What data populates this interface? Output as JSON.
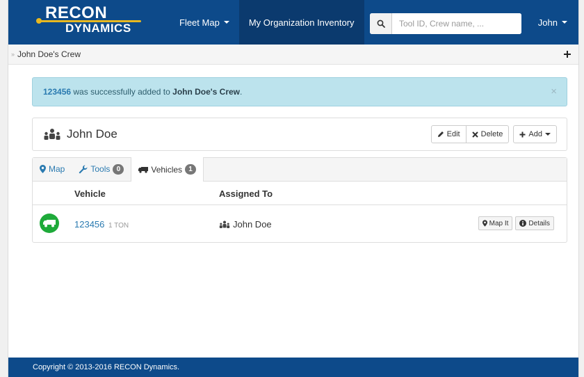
{
  "brand": {
    "line1": "RECON",
    "line2": "DYNAMICS"
  },
  "nav": {
    "fleet_map": "Fleet Map",
    "inventory": "My Organization Inventory",
    "user": "John"
  },
  "search": {
    "placeholder": "Tool ID, Crew name, ..."
  },
  "breadcrumb": {
    "current": "John Doe's Crew"
  },
  "alert": {
    "id": "123456",
    "message": "was successfully added to",
    "target": "John Doe's Crew",
    "end": ".",
    "close": "×"
  },
  "crew": {
    "name": "John Doe",
    "edit_label": "Edit",
    "delete_label": "Delete",
    "add_label": "Add"
  },
  "tabs": [
    {
      "label": "Map",
      "icon": "map-marker-icon"
    },
    {
      "label": "Tools",
      "count": "0",
      "icon": "wrench-icon"
    },
    {
      "label": "Vehicles",
      "count": "1",
      "icon": "truck-icon",
      "active": true
    }
  ],
  "table": {
    "headers": {
      "vehicle": "Vehicle",
      "assigned": "Assigned To"
    },
    "rows": [
      {
        "vehicle_id": "123456",
        "vehicle_type": "1 TON",
        "assigned_to": "John Doe",
        "map_label": "Map It",
        "details_label": "Details",
        "status_color": "#1eaa3a"
      }
    ]
  },
  "footer": {
    "copyright": "Copyright © 2013-2016 RECON Dynamics."
  },
  "colors": {
    "navbar": "#0d4a8a",
    "accent": "#e8b820",
    "link": "#2a7ab0",
    "alert_bg": "#bce3ed"
  }
}
